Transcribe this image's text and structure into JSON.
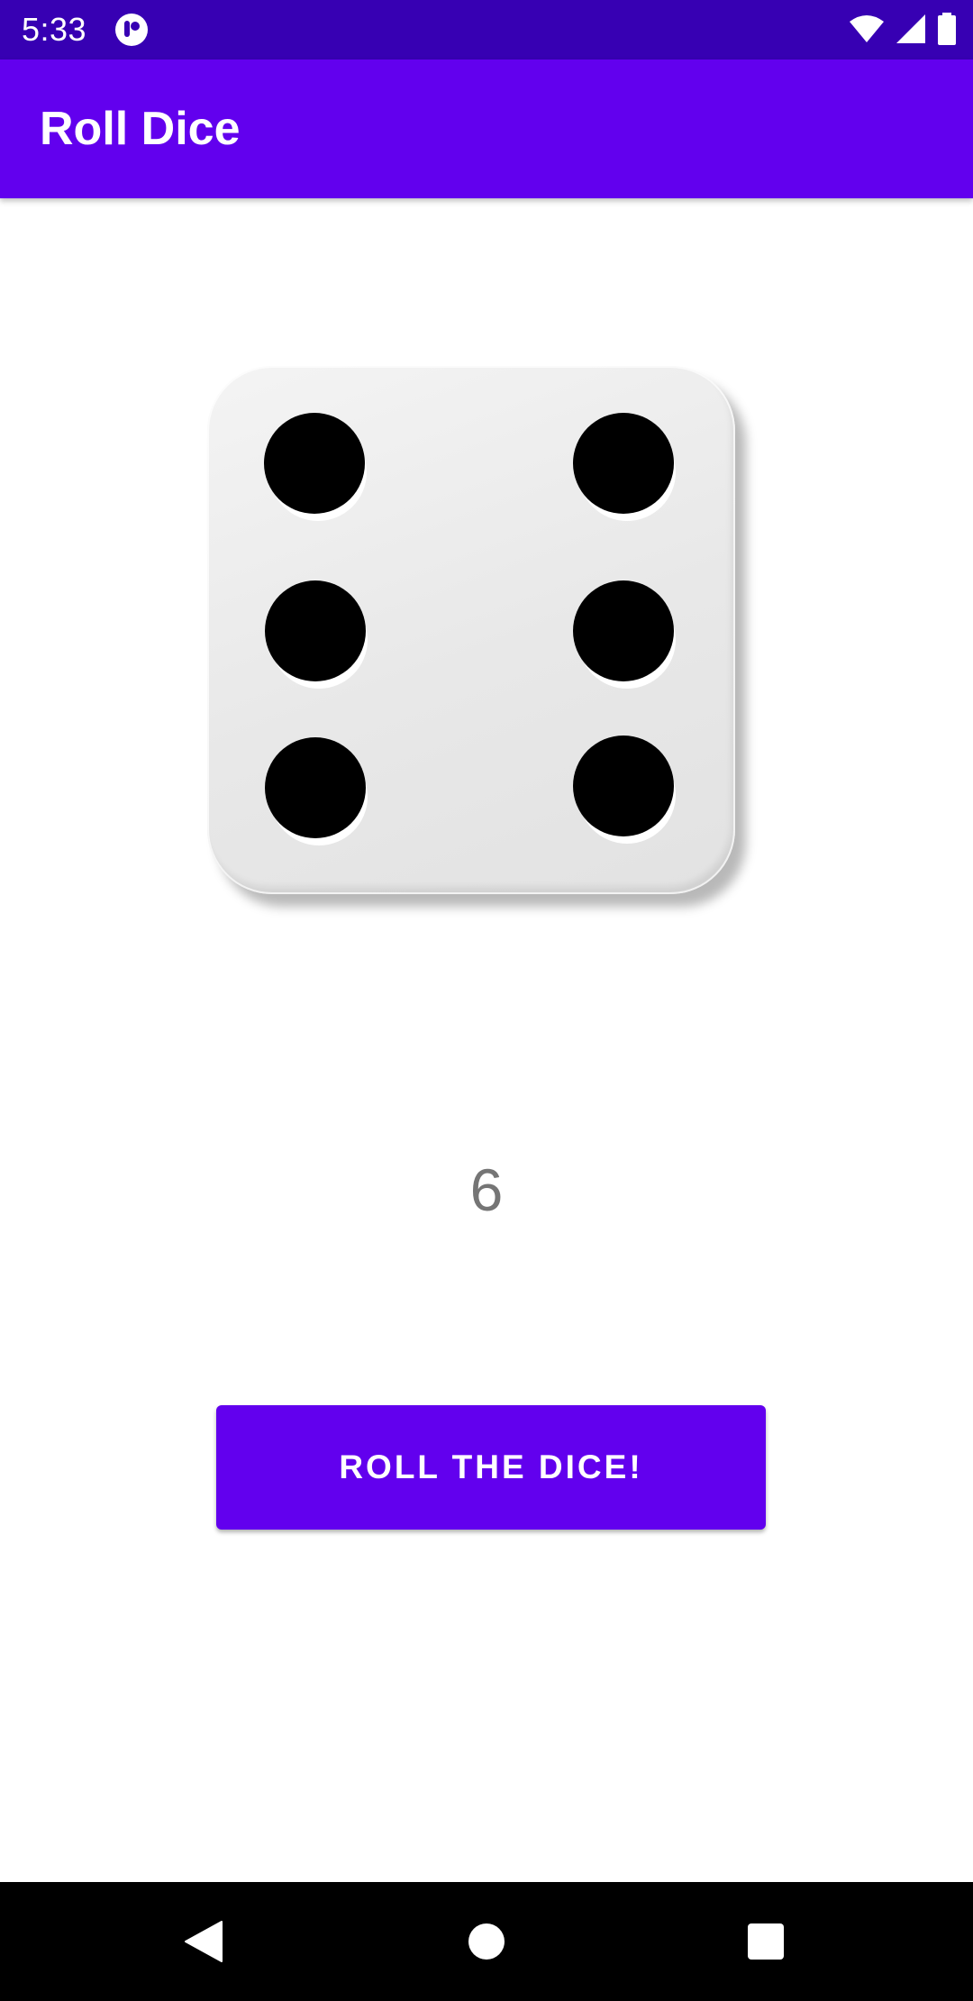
{
  "status_bar": {
    "time": "5:33",
    "icons": [
      "notification-app-icon",
      "wifi-icon",
      "signal-icon",
      "battery-icon"
    ]
  },
  "app_bar": {
    "title": "Roll Dice"
  },
  "dice": {
    "face_value": 6,
    "icon": "dice-six-icon"
  },
  "result": {
    "text": "6"
  },
  "roll_button": {
    "label": "ROLL THE DICE!"
  },
  "nav_bar": {
    "buttons": [
      "back-icon",
      "home-icon",
      "recents-icon"
    ]
  },
  "colors": {
    "status_bar": "#3700b3",
    "primary": "#6200ee",
    "result_text": "#757575",
    "background": "#ffffff"
  }
}
